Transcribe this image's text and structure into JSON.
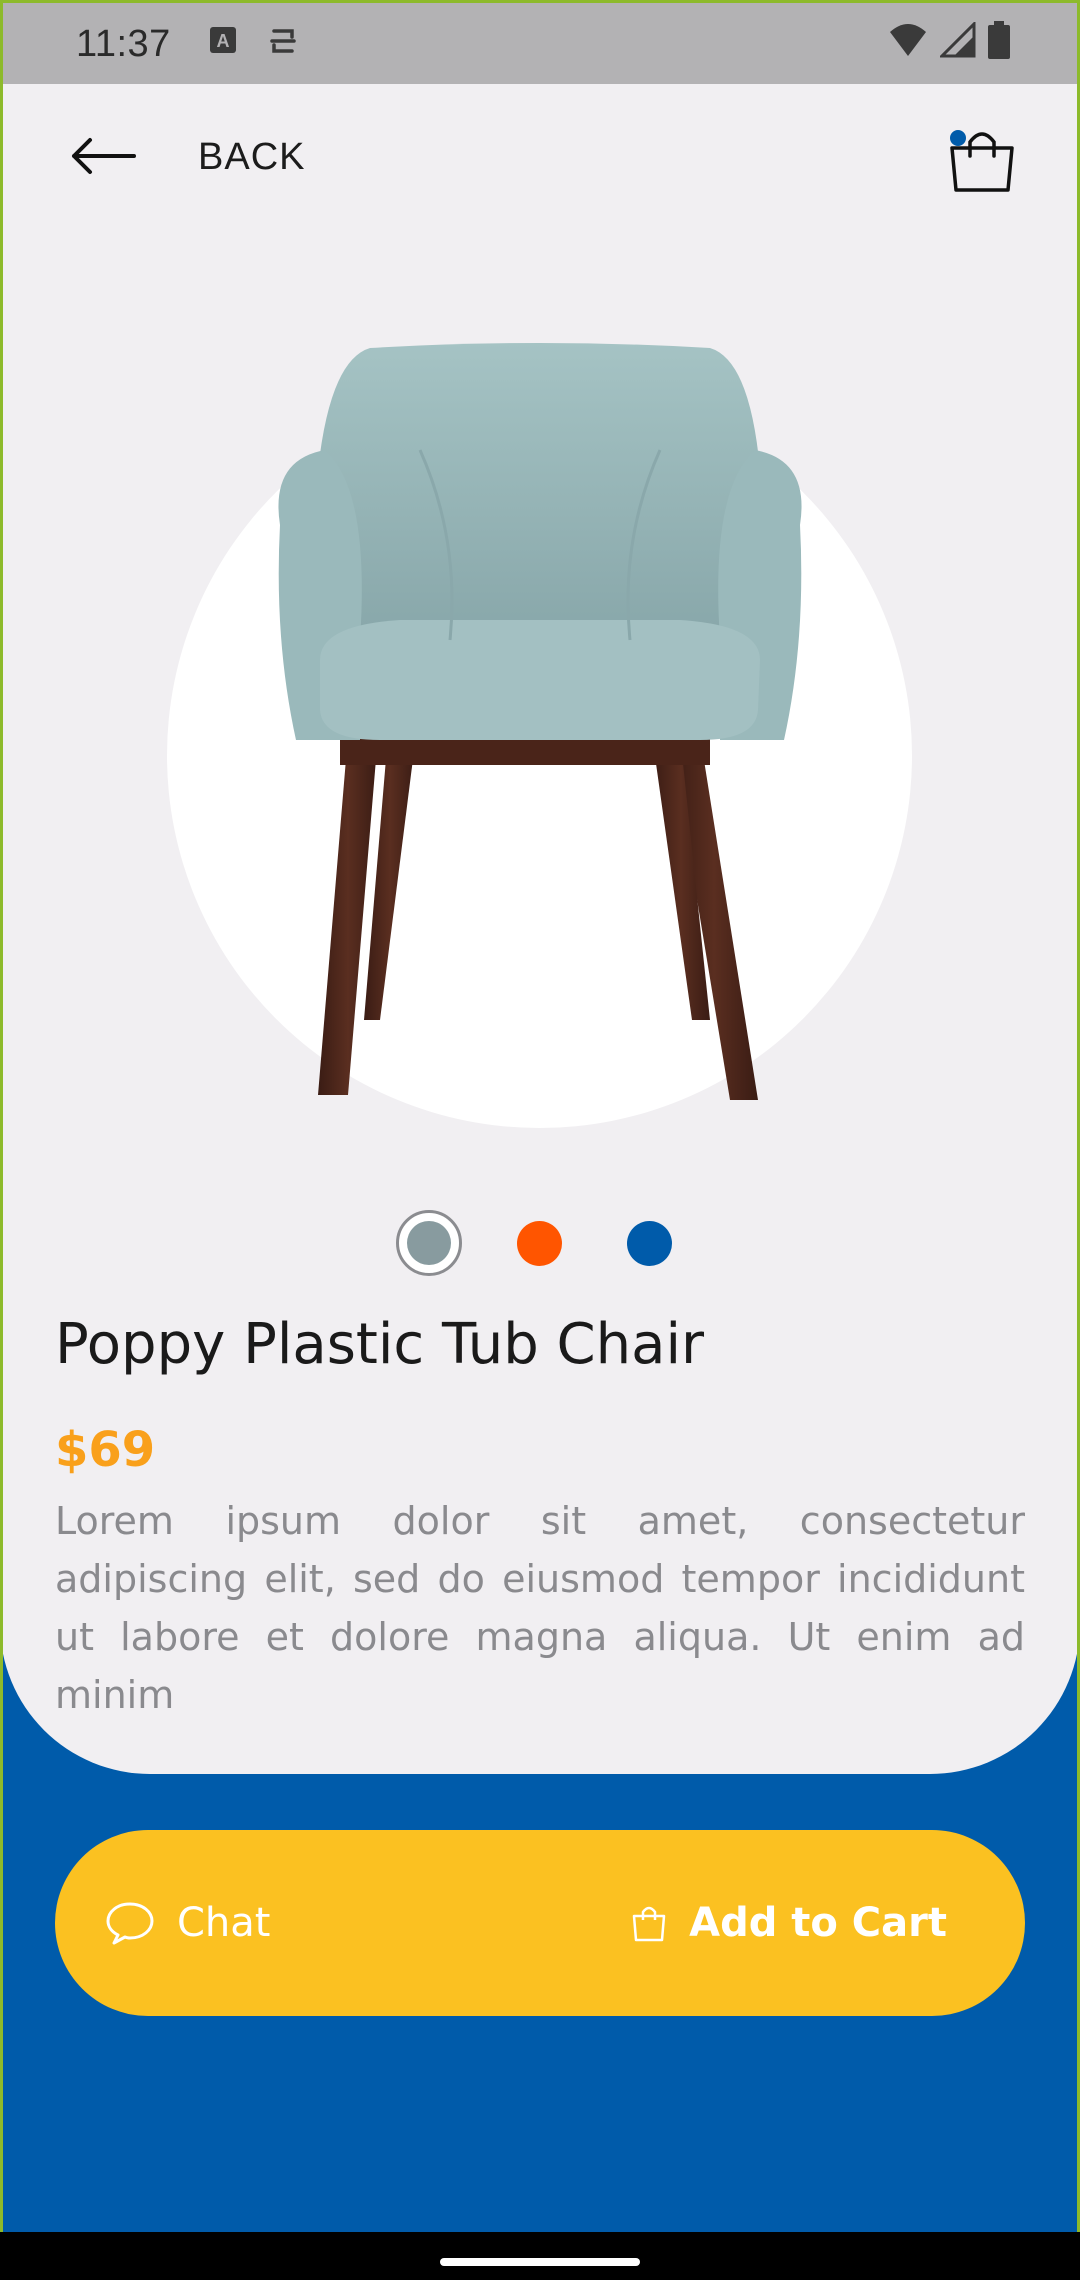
{
  "status_bar": {
    "time": "11:37",
    "icons": [
      "a-icon",
      "sync-icon",
      "wifi-icon",
      "signal-icon",
      "battery-icon"
    ]
  },
  "header": {
    "back_label": "BACK",
    "cart_badge": true
  },
  "product": {
    "title": "Poppy Plastic Tub Chair",
    "price": "$69",
    "description": "Lorem ipsum dolor sit amet, consectetur adipiscing elit, sed do eiusmod tempor incididunt ut labore et dolore magna aliqua. Ut enim ad minim",
    "colors": [
      "#889B9F",
      "#FF5500",
      "#005BAA"
    ],
    "selected_color_index": 0
  },
  "actions": {
    "chat_label": "Chat",
    "add_to_cart_label": "Add to Cart"
  },
  "theme": {
    "primary": "#005BAA",
    "accent": "#FBC121",
    "price_color": "#F9A01B",
    "background": "#F1EFF2"
  }
}
